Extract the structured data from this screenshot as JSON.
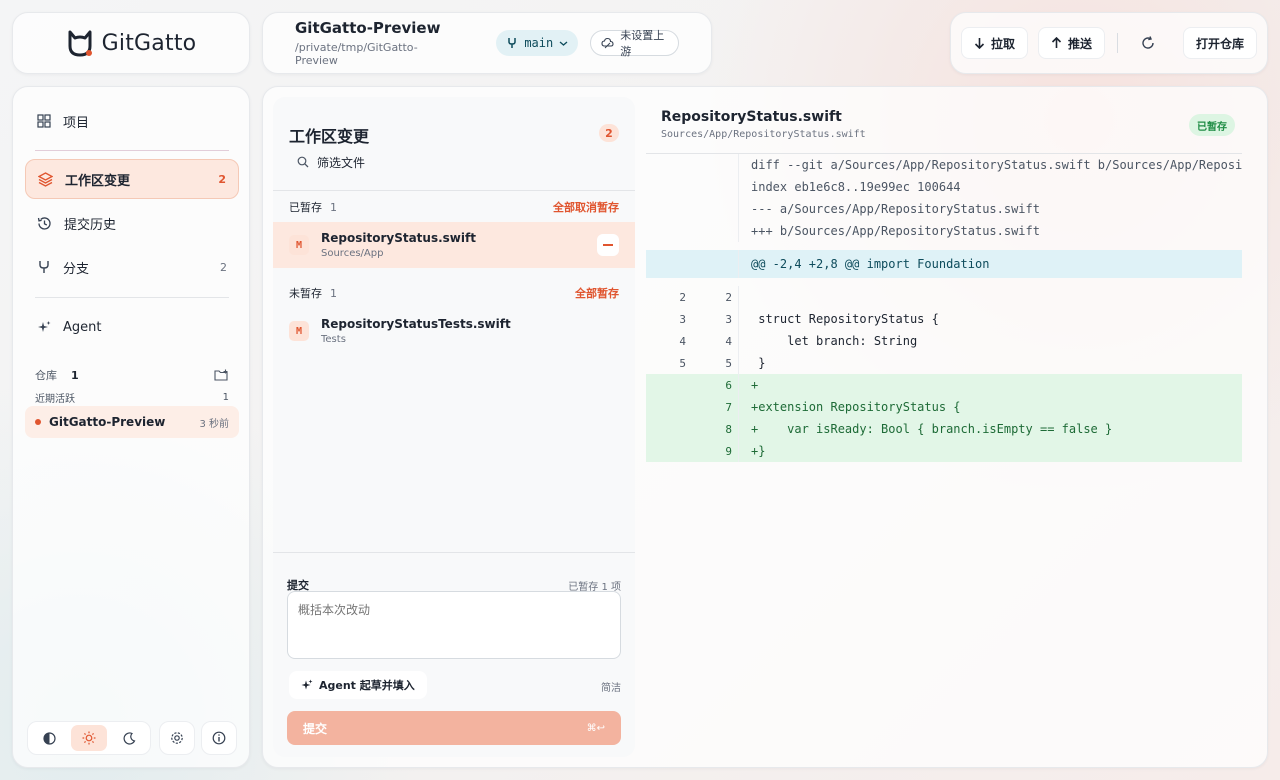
{
  "app": {
    "name": "GitGatto"
  },
  "repo": {
    "name": "GitGatto-Preview",
    "path": "/private/tmp/GitGatto-Preview",
    "branch": "main",
    "upstream": "未设置上游"
  },
  "toolbar": {
    "pull": "拉取",
    "push": "推送",
    "open_repo": "打开仓库"
  },
  "sidebar": {
    "items": [
      {
        "label": "项目",
        "count": ""
      },
      {
        "label": "工作区变更",
        "count": "2"
      },
      {
        "label": "提交历史",
        "count": ""
      },
      {
        "label": "分支",
        "count": "2"
      },
      {
        "label": "Agent",
        "count": ""
      }
    ],
    "repos_label": "仓库",
    "repos_count": "1",
    "recent_label": "近期活跃",
    "recent_count": "1",
    "recent_repo": {
      "name": "GitGatto-Preview",
      "time": "3 秒前"
    }
  },
  "changes": {
    "title": "工作区变更",
    "count": "2",
    "filter_placeholder": "筛选文件",
    "staged": {
      "label": "已暂存",
      "count": "1",
      "action": "全部取消暂存",
      "files": [
        {
          "badge": "M",
          "name": "RepositoryStatus.swift",
          "dir": "Sources/App"
        }
      ]
    },
    "unstaged": {
      "label": "未暂存",
      "count": "1",
      "action": "全部暂存",
      "files": [
        {
          "badge": "M",
          "name": "RepositoryStatusTests.swift",
          "dir": "Tests"
        }
      ]
    }
  },
  "commit": {
    "label": "提交",
    "staged_count": "已暂存 1 项",
    "placeholder": "概括本次改动",
    "agent_button": "Agent 起草并填入",
    "style": "简洁",
    "button": "提交",
    "shortcut": "⌘↩"
  },
  "diff": {
    "file": "RepositoryStatus.swift",
    "path": "Sources/App/RepositoryStatus.swift",
    "status": "已暂存",
    "lines": [
      {
        "type": "meta",
        "old": "",
        "new": "",
        "text": "diff --git a/Sources/App/RepositoryStatus.swift b/Sources/App/Reposit"
      },
      {
        "type": "meta",
        "old": "",
        "new": "",
        "text": "index eb1e6c8..19e99ec 100644"
      },
      {
        "type": "meta",
        "old": "",
        "new": "",
        "text": "--- a/Sources/App/RepositoryStatus.swift"
      },
      {
        "type": "meta",
        "old": "",
        "new": "",
        "text": "+++ b/Sources/App/RepositoryStatus.swift"
      },
      {
        "type": "hunk",
        "old": "",
        "new": "",
        "text": "@@ -2,4 +2,8 @@ import Foundation"
      },
      {
        "type": "ctx",
        "old": "2",
        "new": "2",
        "text": ""
      },
      {
        "type": "ctx",
        "old": "3",
        "new": "3",
        "text": " struct RepositoryStatus {"
      },
      {
        "type": "ctx",
        "old": "4",
        "new": "4",
        "text": "     let branch: String"
      },
      {
        "type": "ctx",
        "old": "5",
        "new": "5",
        "text": " }"
      },
      {
        "type": "add",
        "old": "",
        "new": "6",
        "text": "+"
      },
      {
        "type": "add",
        "old": "",
        "new": "7",
        "text": "+extension RepositoryStatus {"
      },
      {
        "type": "add",
        "old": "",
        "new": "8",
        "text": "+    var isReady: Bool { branch.isEmpty == false }"
      },
      {
        "type": "add",
        "old": "",
        "new": "9",
        "text": "+}"
      }
    ]
  }
}
